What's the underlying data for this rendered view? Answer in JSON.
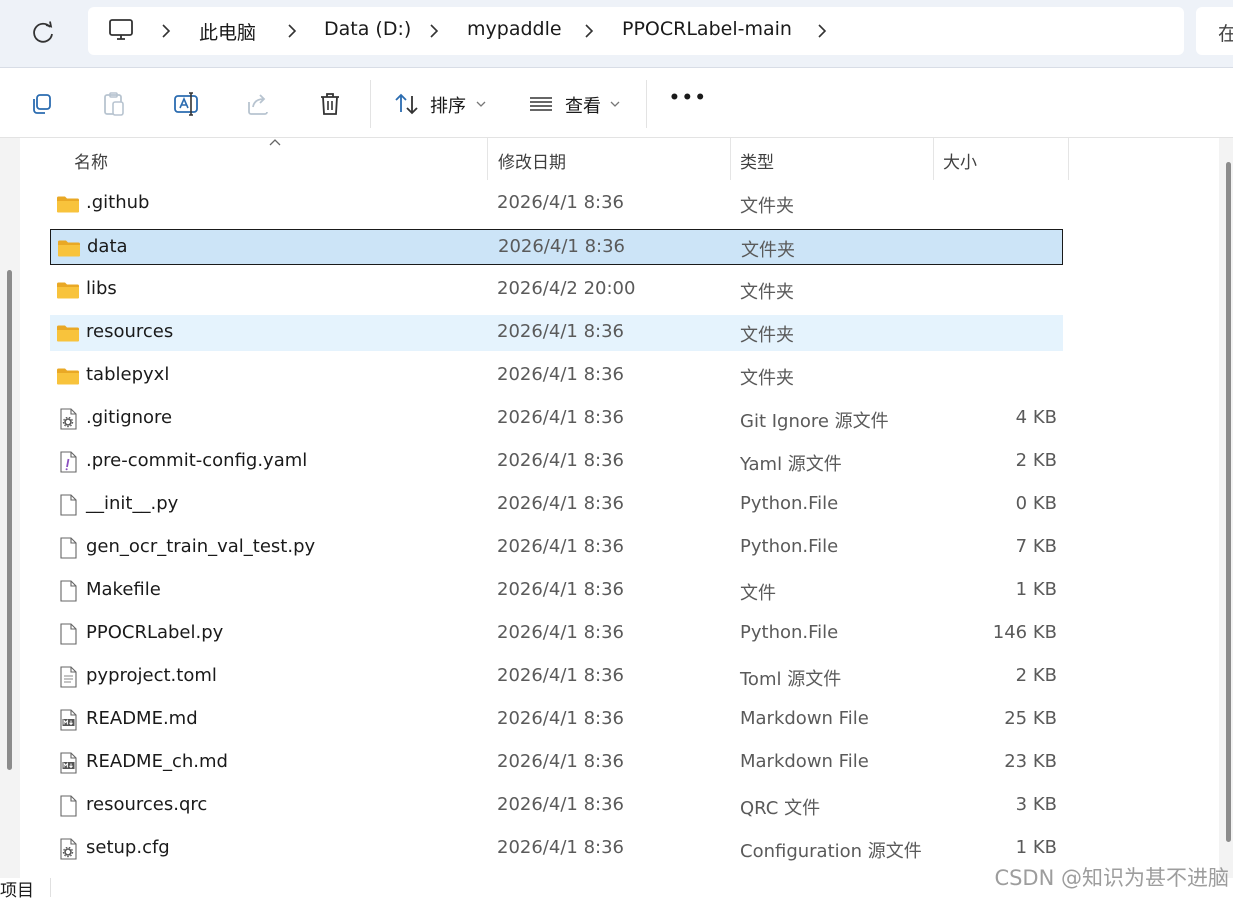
{
  "address": {
    "crumbs": [
      "此电脑",
      "Data (D:)",
      "mypaddle",
      "PPOCRLabel-main"
    ],
    "search_partial": "在"
  },
  "toolbar": {
    "sort_label": "排序",
    "view_label": "查看",
    "more_label": "•••"
  },
  "columns": {
    "name": "名称",
    "date": "修改日期",
    "type": "类型",
    "size": "大小"
  },
  "files": [
    {
      "name": ".github",
      "date": "2026/4/1 8:36",
      "type": "文件夹",
      "size": "",
      "icon": "folder-icon",
      "state": ""
    },
    {
      "name": "data",
      "date": "2026/4/1 8:36",
      "type": "文件夹",
      "size": "",
      "icon": "folder-icon",
      "state": "selected"
    },
    {
      "name": "libs",
      "date": "2026/4/2 20:00",
      "type": "文件夹",
      "size": "",
      "icon": "folder-icon",
      "state": ""
    },
    {
      "name": "resources",
      "date": "2026/4/1 8:36",
      "type": "文件夹",
      "size": "",
      "icon": "folder-icon",
      "state": "hover"
    },
    {
      "name": "tablepyxl",
      "date": "2026/4/1 8:36",
      "type": "文件夹",
      "size": "",
      "icon": "folder-icon",
      "state": ""
    },
    {
      "name": ".gitignore",
      "date": "2026/4/1 8:36",
      "type": "Git Ignore 源文件",
      "size": "4 KB",
      "icon": "config-file-icon",
      "state": ""
    },
    {
      "name": ".pre-commit-config.yaml",
      "date": "2026/4/1 8:36",
      "type": "Yaml 源文件",
      "size": "2 KB",
      "icon": "yaml-file-icon",
      "state": ""
    },
    {
      "name": "__init__.py",
      "date": "2026/4/1 8:36",
      "type": "Python.File",
      "size": "0 KB",
      "icon": "blank-file-icon",
      "state": ""
    },
    {
      "name": "gen_ocr_train_val_test.py",
      "date": "2026/4/1 8:36",
      "type": "Python.File",
      "size": "7 KB",
      "icon": "blank-file-icon",
      "state": ""
    },
    {
      "name": "Makefile",
      "date": "2026/4/1 8:36",
      "type": "文件",
      "size": "1 KB",
      "icon": "blank-file-icon",
      "state": ""
    },
    {
      "name": "PPOCRLabel.py",
      "date": "2026/4/1 8:36",
      "type": "Python.File",
      "size": "146 KB",
      "icon": "blank-file-icon",
      "state": ""
    },
    {
      "name": "pyproject.toml",
      "date": "2026/4/1 8:36",
      "type": "Toml 源文件",
      "size": "2 KB",
      "icon": "text-file-icon",
      "state": ""
    },
    {
      "name": "README.md",
      "date": "2026/4/1 8:36",
      "type": "Markdown File",
      "size": "25 KB",
      "icon": "markdown-file-icon",
      "state": ""
    },
    {
      "name": "README_ch.md",
      "date": "2026/4/1 8:36",
      "type": "Markdown File",
      "size": "23 KB",
      "icon": "markdown-file-icon",
      "state": ""
    },
    {
      "name": "resources.qrc",
      "date": "2026/4/1 8:36",
      "type": "QRC 文件",
      "size": "3 KB",
      "icon": "blank-file-icon",
      "state": ""
    },
    {
      "name": "setup.cfg",
      "date": "2026/4/1 8:36",
      "type": "Configuration 源文件",
      "size": "1 KB",
      "icon": "config-file-icon",
      "state": ""
    }
  ],
  "status": {
    "items_label": "项目"
  },
  "watermark": "CSDN @知识为甚不进脑",
  "colors": {
    "selected_bg": "#cce4f7",
    "hover_bg": "#e5f3fd",
    "folder": "#f8c33c"
  }
}
